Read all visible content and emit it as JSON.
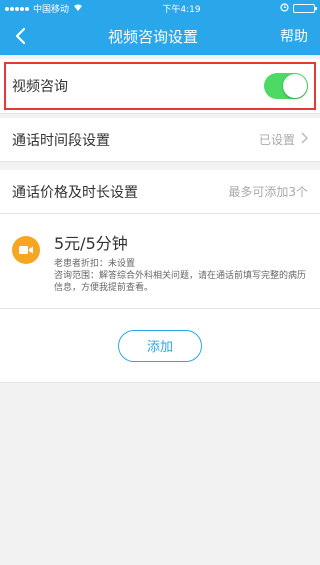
{
  "status_bar": {
    "carrier": "中国移动",
    "time": "下午4:19"
  },
  "header": {
    "title": "视频咨询设置",
    "help": "帮助"
  },
  "video_consult": {
    "label": "视频咨询",
    "enabled": true
  },
  "time_setting": {
    "label": "通话时间段设置",
    "status": "已设置"
  },
  "price_setting": {
    "label": "通话价格及时长设置",
    "hint": "最多可添加3个"
  },
  "price_item": {
    "price": "5元/5分钟",
    "discount": "老患者折扣：未设置",
    "scope": "咨询范围：解答综合外科相关问题，请在通话前填写完整的病历信息，方便我提前查看。"
  },
  "add_button": "添加",
  "colors": {
    "header_bg": "#2aa7ea",
    "toggle_on": "#4cd964",
    "highlight": "#e53935",
    "icon_bg": "#f5a623"
  }
}
